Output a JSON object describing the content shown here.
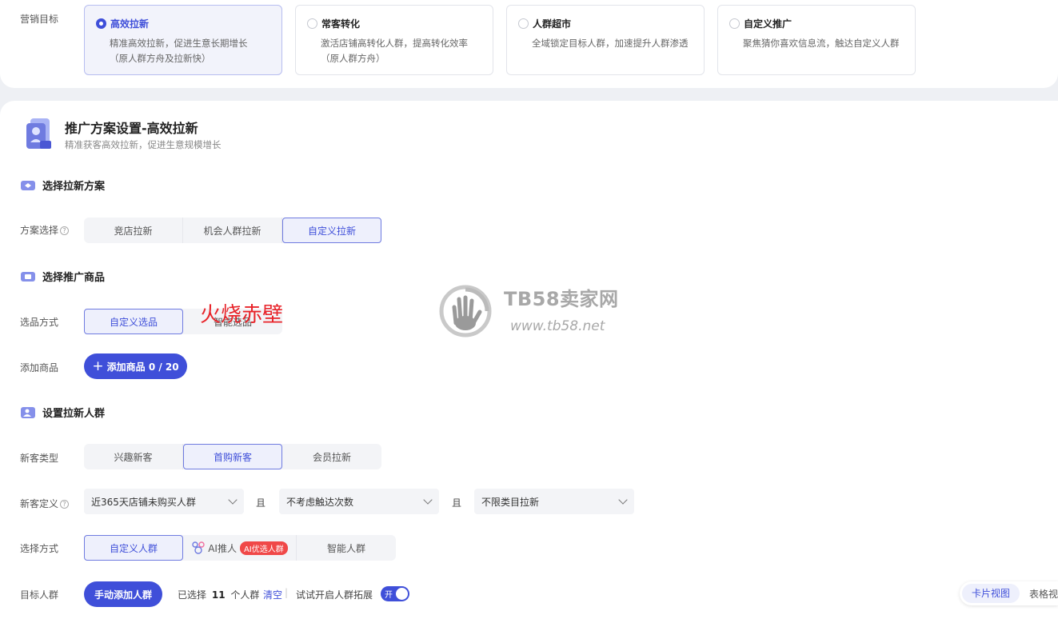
{
  "goal": {
    "label": "营销目标",
    "options": [
      {
        "title": "高效拉新",
        "desc": [
          "精准高效拉新，促进生意长期增长",
          "（原人群方舟及拉新快）"
        ],
        "selected": true
      },
      {
        "title": "常客转化",
        "desc": [
          "激活店铺高转化人群，提高转化效率",
          "（原人群方舟）"
        ],
        "selected": false
      },
      {
        "title": "人群超市",
        "desc": [
          "全域锁定目标人群，加速提升人群渗透"
        ],
        "selected": false
      },
      {
        "title": "自定义推广",
        "desc": [
          "聚焦猜你喜欢信息流，触达自定义人群"
        ],
        "selected": false
      }
    ]
  },
  "plan": {
    "title": "推广方案设置-高效拉新",
    "subtitle": "精准获客高效拉新，促进生意规模增长"
  },
  "section1": {
    "title": "选择拉新方案",
    "scheme_label": "方案选择",
    "help": "?",
    "options": [
      "竞店拉新",
      "机会人群拉新",
      "自定义拉新"
    ],
    "active": "自定义拉新"
  },
  "section2": {
    "title": "选择推广商品",
    "pick_label": "选品方式",
    "pick_options": [
      "自定义选品",
      "智能选品"
    ],
    "add_label": "添加商品",
    "add_button": "添加商品 0 / 20",
    "add_icon": "plus-icon"
  },
  "section3": {
    "title": "设置拉新人群",
    "type_label": "新客类型",
    "type_options": [
      "兴趣新客",
      "首购新客",
      "会员拉新"
    ],
    "def_label": "新客定义",
    "help": "?",
    "selects": [
      "近365天店铺未购买人群",
      "不考虑触达次数",
      "不限类目拉新"
    ],
    "and": "且",
    "method_label": "选择方式",
    "method_custom": "自定义人群",
    "method_ai": "AI推人",
    "method_ai_badge": "AI优选人群",
    "method_smart": "智能人群",
    "target_label": "目标人群",
    "target_button": "手动添加人群",
    "selected_prefix": "已选择",
    "selected_count": "11",
    "selected_suffix": "个人群",
    "clear": "清空",
    "separator": "|",
    "expand": "试试开启人群拓展",
    "toggle": "开"
  },
  "views": {
    "card": "卡片视图",
    "table": "表格视"
  },
  "watermark": {
    "name": "TB58卖家网",
    "url": "www.tb58.net"
  },
  "stamp": "火烧赤壁",
  "colors": {
    "accent": "#3f4fd9",
    "badge": "#f04848",
    "stamp": "#e8252b"
  }
}
